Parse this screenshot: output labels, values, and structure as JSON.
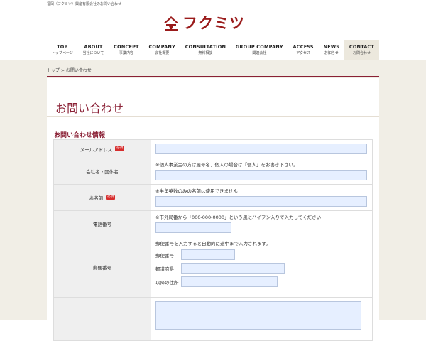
{
  "header": {
    "tagline": "福岡（フクミツ）興産有限会社のお問い合わせ",
    "logo_text": "フクミツ",
    "brand_color": "#9a1b1b"
  },
  "nav": {
    "items": [
      {
        "en": "TOP",
        "jp": "トップページ"
      },
      {
        "en": "ABOUT",
        "jp": "当社について"
      },
      {
        "en": "CONCEPT",
        "jp": "事業内容"
      },
      {
        "en": "COMPANY",
        "jp": "会社概要"
      },
      {
        "en": "CONSULTATION",
        "jp": "無料相談"
      },
      {
        "en": "GROUP COMPANY",
        "jp": "関連会社"
      },
      {
        "en": "ACCESS",
        "jp": "アクセス"
      },
      {
        "en": "NEWS",
        "jp": "お知らせ"
      },
      {
        "en": "CONTACT",
        "jp": "お問合わせ"
      }
    ],
    "active": "CONTACT"
  },
  "breadcrumb": {
    "home": "トップ",
    "separator": ">",
    "current": "お問い合わせ"
  },
  "page": {
    "title": "お問い合わせ",
    "section_title": "お問い合わせ情報",
    "accent_color": "#8a2035"
  },
  "form": {
    "required_badge": "必須",
    "email": {
      "label": "メールアドレス"
    },
    "company": {
      "label": "会社名・団体名",
      "note": "※個人事業主の方は屋号名、個人の場合は「個人」をお書き下さい。"
    },
    "name": {
      "label": "お名前",
      "note": "※半角英数のみの名前は使用できません"
    },
    "phone": {
      "label": "電話番号",
      "note": "※市外局番から「000-000-0000」という風にハイフン入りで入力してください"
    },
    "postal": {
      "label": "郵便番号",
      "note": "郵便番号を入力すると自動的に途中まで入力されます。",
      "zip_label": "郵便番号",
      "pref_label": "都道府県",
      "rest_label": "以降の住所"
    }
  }
}
